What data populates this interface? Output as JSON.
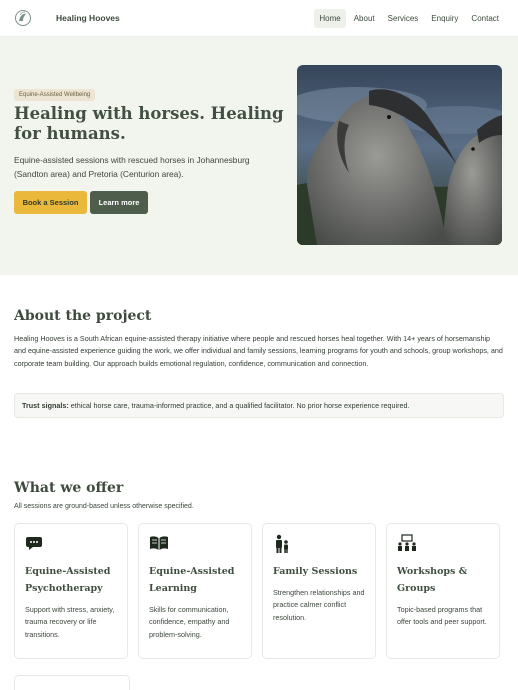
{
  "brand": {
    "logo_text": "Healing Hooves",
    "name": "Healing Hooves"
  },
  "nav": {
    "items": [
      {
        "label": "Home",
        "active": true
      },
      {
        "label": "About"
      },
      {
        "label": "Services"
      },
      {
        "label": "Enquiry"
      },
      {
        "label": "Contact"
      }
    ]
  },
  "hero": {
    "badge": "Equine-Assisted Wellbeing",
    "title": "Healing with horses. Healing for humans.",
    "subtitle": "Equine-assisted sessions with rescued horses in Johannesburg (Sandton area) and Pretoria (Centurion area).",
    "primary_cta": "Book a Session",
    "secondary_cta": "Learn more"
  },
  "about": {
    "title": "About the project",
    "body": "Healing Hooves is a South African equine-assisted therapy initiative where people and rescued horses heal together. With 14+ years of horsemanship and equine-assisted experience guiding the work, we offer individual and family sessions, learning programs for youth and schools, group workshops, and corporate team building. Our approach builds emotional regulation, confidence, communication and connection.",
    "trust_label": "Trust signals:",
    "trust_text": " ethical horse care, trauma-informed practice, and a qualified facilitator. No prior horse experience required."
  },
  "offer": {
    "title": "What we offer",
    "subtitle": "All sessions are ground-based unless otherwise specified.",
    "cards": [
      {
        "icon": "chat-bubble-icon",
        "title": "Equine-Assisted Psychotherapy",
        "text": "Support with stress, anxiety, trauma recovery or life transitions."
      },
      {
        "icon": "book-icon",
        "title": "Equine-Assisted Learning",
        "text": "Skills for communication, confidence, empathy and problem-solving."
      },
      {
        "icon": "family-icon",
        "title": "Family Sessions",
        "text": "Strengthen relationships and practice calmer conflict resolution."
      },
      {
        "icon": "workshop-group-icon",
        "title": "Workshops & Groups",
        "text": "Topic-based programs that offer tools and peer support."
      }
    ]
  },
  "colors": {
    "accent": "#eab83a",
    "dark_green": "#4f5d4d",
    "hero_bg": "#f2f4ee",
    "heading": "#425042"
  }
}
